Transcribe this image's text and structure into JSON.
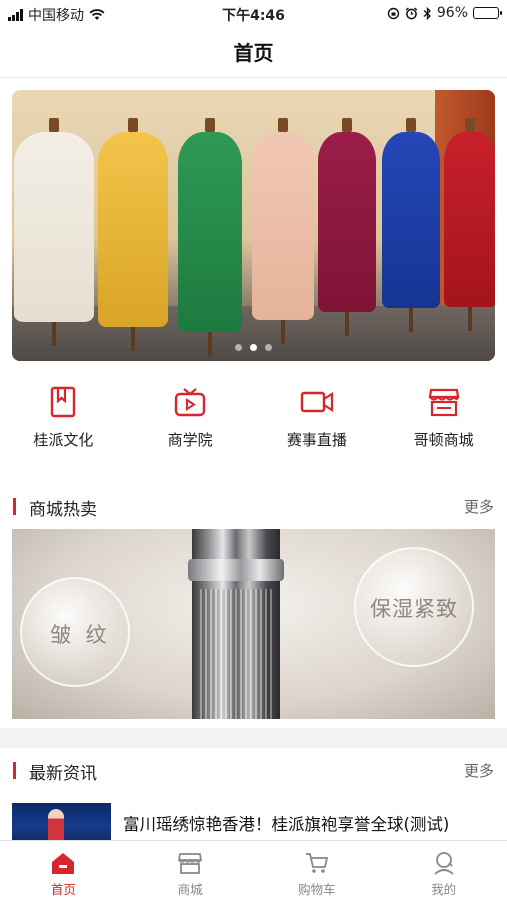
{
  "status_bar": {
    "carrier": "中国移动",
    "time": "下午4:46",
    "battery": "96%",
    "battery_level": 0.96
  },
  "nav": {
    "title": "首页"
  },
  "banner": {
    "slide_count": 3,
    "active_slide": 1
  },
  "quick_nav": [
    {
      "label": "桂派文化",
      "icon": "book-icon"
    },
    {
      "label": "商学院",
      "icon": "tv-icon"
    },
    {
      "label": "赛事直播",
      "icon": "video-camera-icon"
    },
    {
      "label": "哥顿商城",
      "icon": "store-icon"
    }
  ],
  "hot_sale": {
    "title": "商城热卖",
    "more": "更多",
    "product_text_left": "皱 纹",
    "product_text_right": "保湿紧致"
  },
  "news": {
    "title": "最新资讯",
    "more": "更多",
    "items": [
      {
        "title": "富川瑶绣惊艳香港！桂派旗袍享誉全球(测试)"
      }
    ]
  },
  "tab_bar": {
    "tabs": [
      {
        "label": "首页",
        "icon": "home-icon",
        "active": true
      },
      {
        "label": "商城",
        "icon": "shop-icon",
        "active": false
      },
      {
        "label": "购物车",
        "icon": "cart-icon",
        "active": false
      },
      {
        "label": "我的",
        "icon": "user-icon",
        "active": false
      }
    ]
  },
  "colors": {
    "accent": "#d7262b",
    "inactive": "#888888",
    "background": "#f2f2f4"
  }
}
